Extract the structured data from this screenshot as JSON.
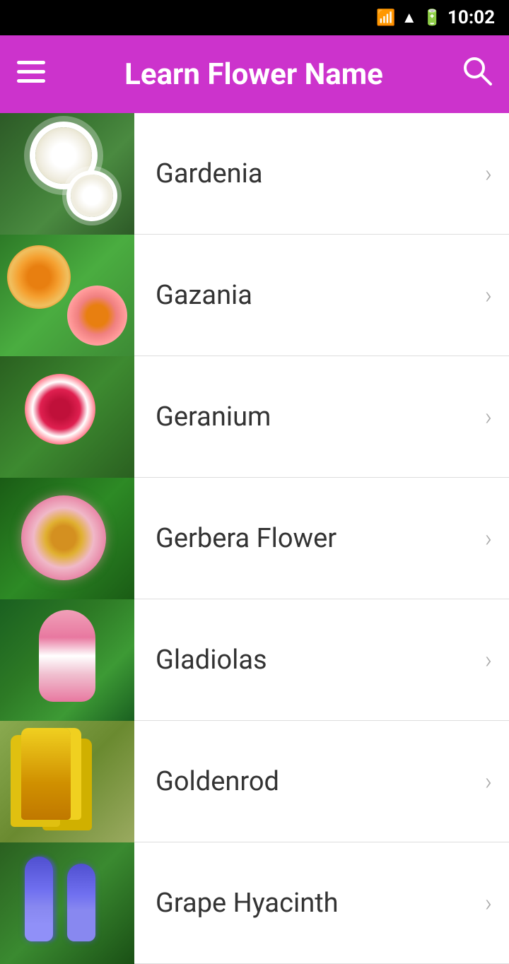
{
  "statusBar": {
    "time": "10:02"
  },
  "appBar": {
    "title": "Learn Flower Name",
    "menuLabel": "☰",
    "searchLabel": "⌕"
  },
  "flowers": [
    {
      "id": "gardenia",
      "name": "Gardenia",
      "imgClass": "img-gardenia"
    },
    {
      "id": "gazania",
      "name": "Gazania",
      "imgClass": "img-gazania"
    },
    {
      "id": "geranium",
      "name": "Geranium",
      "imgClass": "img-geranium"
    },
    {
      "id": "gerbera-flower",
      "name": "Gerbera Flower",
      "imgClass": "img-gerbera"
    },
    {
      "id": "gladiolas",
      "name": "Gladiolas",
      "imgClass": "img-gladiolas"
    },
    {
      "id": "goldenrod",
      "name": "Goldenrod",
      "imgClass": "img-goldenrod"
    },
    {
      "id": "grape-hyacinth",
      "name": "Grape Hyacinth",
      "imgClass": "img-grape-hyacinth"
    }
  ],
  "chevron": "›"
}
